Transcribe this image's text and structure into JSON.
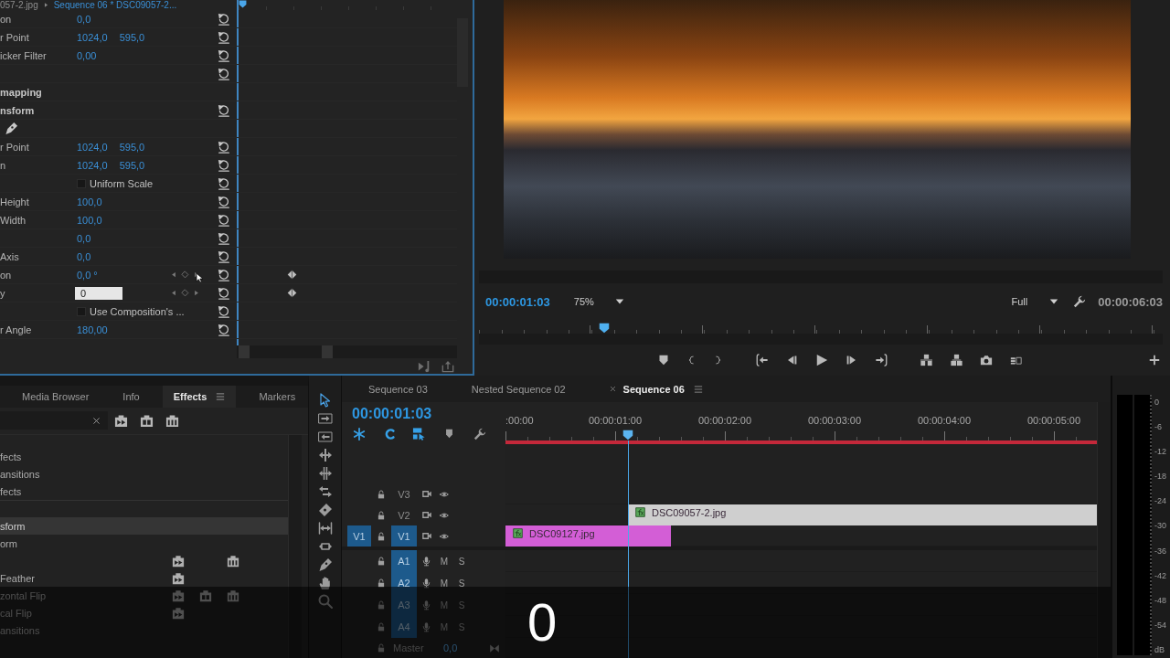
{
  "effect_controls": {
    "header": {
      "source": "057-2.jpg",
      "sequence": "Sequence 06 * DSC09057-2..."
    },
    "properties": [
      {
        "kind": "value",
        "label": "on",
        "values": [
          "0,0"
        ],
        "keyframed": false,
        "reset": true
      },
      {
        "kind": "value",
        "label": "r Point",
        "values": [
          "1024,0",
          "595,0"
        ],
        "keyframed": false,
        "reset": true
      },
      {
        "kind": "value",
        "label": "icker Filter",
        "values": [
          "0,00"
        ],
        "keyframed": false,
        "reset": true
      },
      {
        "kind": "blank",
        "keyframed": false,
        "reset": true
      },
      {
        "kind": "section",
        "label": "mapping",
        "keyframed": false,
        "reset": false
      },
      {
        "kind": "section",
        "label": "nsform",
        "keyframed": false,
        "reset": true
      },
      {
        "kind": "tools",
        "keyframed": false,
        "reset": false
      },
      {
        "kind": "value",
        "label": "r Point",
        "values": [
          "1024,0",
          "595,0"
        ],
        "keyframed": false,
        "reset": true
      },
      {
        "kind": "value",
        "label": "n",
        "values": [
          "1024,0",
          "595,0"
        ],
        "keyframed": false,
        "reset": true
      },
      {
        "kind": "checkbox",
        "label": "Uniform Scale",
        "checked": false,
        "keyframed": false,
        "reset": true
      },
      {
        "kind": "value",
        "label": "Height",
        "values": [
          "100,0"
        ],
        "keyframed": false,
        "reset": true
      },
      {
        "kind": "value",
        "label": "Width",
        "values": [
          "100,0"
        ],
        "keyframed": false,
        "reset": true
      },
      {
        "kind": "value",
        "values": [
          "0,0"
        ],
        "keyframed": false,
        "reset": true
      },
      {
        "kind": "value",
        "label": "Axis",
        "values": [
          "0,0"
        ],
        "keyframed": false,
        "reset": true
      },
      {
        "kind": "value",
        "label": "on",
        "values": [
          "0,0 °"
        ],
        "keyframed": true,
        "reset": true
      },
      {
        "kind": "input",
        "label": "y",
        "value": "0",
        "keyframed": true,
        "reset": true
      },
      {
        "kind": "checkbox",
        "label": "Use Composition's ...",
        "checked": false,
        "keyframed": false,
        "reset": true
      },
      {
        "kind": "value",
        "label": "r Angle",
        "values": [
          "180,00"
        ],
        "keyframed": false,
        "reset": true
      }
    ]
  },
  "program": {
    "timecode": "00:00:01:03",
    "zoom": "75%",
    "resolution": "Full",
    "duration": "00:00:06:03",
    "scrubber": {
      "level": 0.183
    }
  },
  "effects_panel": {
    "tabs": [
      {
        "label": "Media Browser",
        "selected": false
      },
      {
        "label": "Info",
        "selected": false
      },
      {
        "label": "Effects",
        "selected": true
      },
      {
        "label": "Markers",
        "selected": false
      }
    ],
    "groups": [
      [
        {
          "label": "fects",
          "selected": false,
          "accelerated": false,
          "color_32bit": false,
          "yuv": false
        },
        {
          "label": "ansitions",
          "selected": false,
          "accelerated": false,
          "color_32bit": false,
          "yuv": false
        },
        {
          "label": "fects",
          "selected": false,
          "accelerated": false,
          "color_32bit": false,
          "yuv": false
        }
      ],
      [
        {
          "label": "sform",
          "selected": true,
          "accelerated": false,
          "color_32bit": false,
          "yuv": false
        },
        {
          "label": "orm",
          "selected": false,
          "accelerated": false,
          "color_32bit": false,
          "yuv": false
        },
        {
          "selected": false,
          "accelerated": true,
          "color_32bit": false,
          "yuv": true
        },
        {
          "label": "Feather",
          "selected": false,
          "accelerated": true,
          "color_32bit": false,
          "yuv": false
        },
        {
          "label": "zontal Flip",
          "selected": false,
          "accelerated": true,
          "color_32bit": true,
          "yuv": true
        },
        {
          "label": "cal Flip",
          "selected": false,
          "accelerated": true,
          "color_32bit": false,
          "yuv": false
        },
        {
          "label": "ansitions",
          "selected": false,
          "accelerated": false,
          "color_32bit": false,
          "yuv": false
        }
      ]
    ]
  },
  "tools": [
    {
      "selected": true
    },
    {
      "selected": false
    },
    {
      "selected": false
    },
    {
      "selected": false
    },
    {
      "selected": false
    },
    {
      "selected": false
    },
    {
      "selected": false
    },
    {
      "selected": false
    },
    {
      "selected": false
    },
    {
      "selected": false
    },
    {
      "selected": false
    },
    {
      "selected": false
    }
  ],
  "timeline": {
    "tabs": [
      {
        "label": "Sequence 03",
        "selected": false
      },
      {
        "label": "Nested Sequence 02",
        "selected": false
      },
      {
        "label": "Sequence 06",
        "selected": true
      }
    ],
    "timecode": "00:00:01:03",
    "toggles": [
      {
        "kind": "nest",
        "on": true
      },
      {
        "kind": "snap",
        "on": true
      },
      {
        "kind": "linked",
        "on": true
      },
      {
        "kind": "marker",
        "on": false
      },
      {
        "kind": "settings",
        "on": false
      }
    ],
    "ruler": [
      ":00:00",
      "00:00:01:00",
      "00:00:02:00",
      "00:00:03:00",
      "00:00:04:00",
      "00:00:05:00"
    ],
    "playhead": {
      "level": 0.207
    },
    "video_tracks": [
      {
        "name": "V3",
        "targeted": false
      },
      {
        "name": "V2",
        "targeted": false,
        "clips": [
          {
            "name": "DSC09057-2.jpg",
            "color": "#cfcfcf"
          }
        ]
      },
      {
        "name": "V1",
        "targeted": true,
        "source": "V1",
        "clips": [
          {
            "name": "DSC09127.jpg",
            "color": "#d35ed6"
          }
        ]
      }
    ],
    "audio_tracks": [
      {
        "name": "A1",
        "targeted": true,
        "mute": "M",
        "solo": "S"
      },
      {
        "name": "A2",
        "targeted": true,
        "mute": "M",
        "solo": "S"
      },
      {
        "name": "A3",
        "targeted": true,
        "mute": "M",
        "solo": "S"
      },
      {
        "name": "A4",
        "targeted": true,
        "mute": "M",
        "solo": "S"
      }
    ],
    "master": {
      "name": "Master",
      "value": "0,0"
    }
  },
  "meter_scale": [
    "0",
    "-6",
    "-12",
    "-18",
    "-24",
    "-30",
    "-36",
    "-42",
    "-48",
    "-54",
    "dB"
  ],
  "caption": "0"
}
